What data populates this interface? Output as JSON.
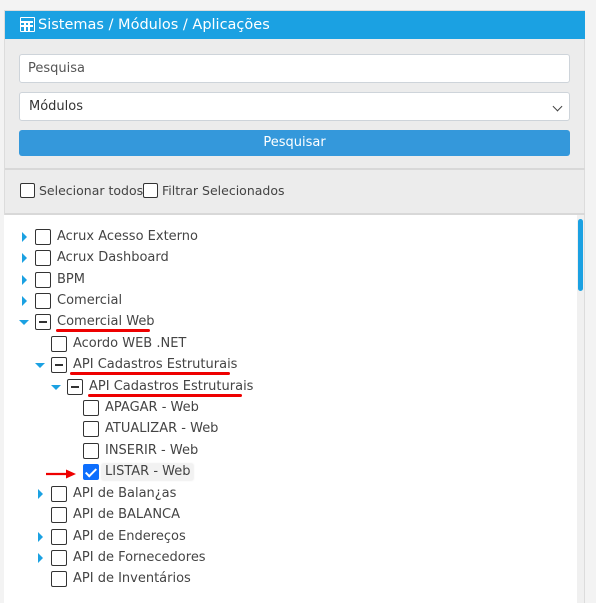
{
  "header": {
    "title": "Sistemas / Módulos / Aplicações"
  },
  "search": {
    "placeholder": "Pesquisa",
    "value": ""
  },
  "filter_select": {
    "selected": "Módulos"
  },
  "search_button": {
    "label": "Pesquisar"
  },
  "options": {
    "select_all": "Selecionar todos",
    "filter_selected": "Filtrar Selecionados"
  },
  "tree": {
    "items": [
      {
        "label": "Acrux Acesso Externo",
        "state": "unchecked",
        "expander": "collapsed"
      },
      {
        "label": "Acrux Dashboard",
        "state": "unchecked",
        "expander": "collapsed"
      },
      {
        "label": "BPM",
        "state": "unchecked",
        "expander": "collapsed"
      },
      {
        "label": "Comercial",
        "state": "unchecked",
        "expander": "collapsed"
      },
      {
        "label": "Comercial Web",
        "state": "indeterminate",
        "expander": "expanded"
      },
      {
        "label": "Acordo WEB .NET",
        "state": "unchecked",
        "expander": "none"
      },
      {
        "label": "API Cadastros Estruturais",
        "state": "indeterminate",
        "expander": "expanded"
      },
      {
        "label": "API Cadastros Estruturais",
        "state": "indeterminate",
        "expander": "expanded"
      },
      {
        "label": "APAGAR - Web",
        "state": "unchecked",
        "expander": "none"
      },
      {
        "label": "ATUALIZAR - Web",
        "state": "unchecked",
        "expander": "none"
      },
      {
        "label": "INSERIR - Web",
        "state": "unchecked",
        "expander": "none"
      },
      {
        "label": "LISTAR - Web",
        "state": "checked",
        "expander": "none"
      },
      {
        "label": "API de Balan¿as",
        "state": "unchecked",
        "expander": "collapsed"
      },
      {
        "label": "API de BALANCA",
        "state": "unchecked",
        "expander": "none"
      },
      {
        "label": "API de Endereços",
        "state": "unchecked",
        "expander": "collapsed"
      },
      {
        "label": "API de Fornecedores",
        "state": "unchecked",
        "expander": "collapsed"
      },
      {
        "label": "API de Inventários",
        "state": "unchecked",
        "expander": "none"
      }
    ]
  },
  "colors": {
    "header": "#1ba1e2",
    "button": "#3498db",
    "tree_arrow": "#1ba1e2",
    "annotation": "#e00000"
  },
  "icons": [
    "table-icon",
    "chevron-down-icon",
    "caret-right-icon",
    "caret-down-icon",
    "annotation-arrow-icon"
  ]
}
